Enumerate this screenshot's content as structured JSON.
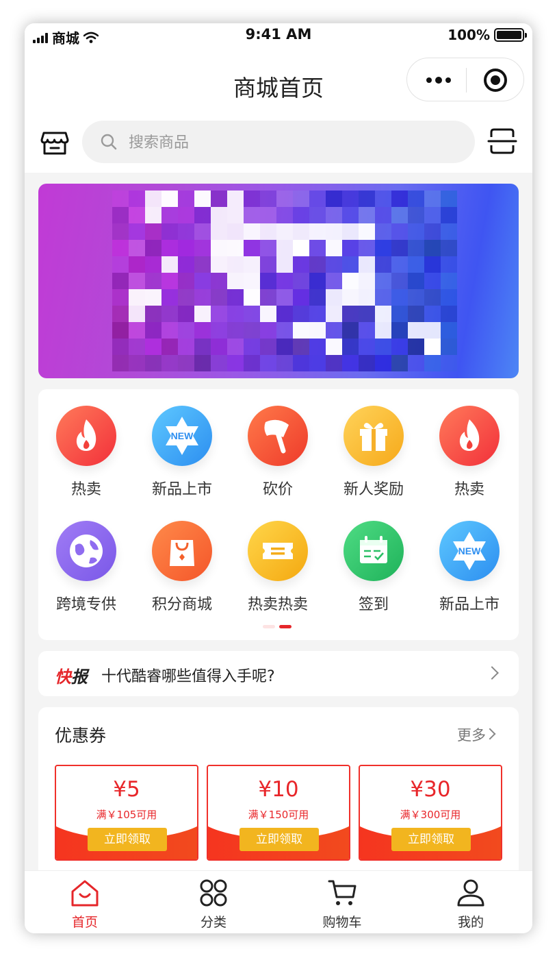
{
  "status_bar": {
    "carrier": "商城",
    "time": "9:41 AM",
    "battery": "100%"
  },
  "nav": {
    "title": "商城首页"
  },
  "search": {
    "placeholder": "搜索商品"
  },
  "grid": {
    "row1": [
      {
        "label": "热卖",
        "icon": "flame-icon"
      },
      {
        "label": "新品上市",
        "icon": "new-badge-icon"
      },
      {
        "label": "砍价",
        "icon": "axe-icon"
      },
      {
        "label": "新人奖励",
        "icon": "gift-icon"
      },
      {
        "label": "热卖",
        "icon": "flame-icon"
      }
    ],
    "row2": [
      {
        "label": "跨境专供",
        "icon": "globe-icon"
      },
      {
        "label": "积分商城",
        "icon": "shopping-bag-icon"
      },
      {
        "label": "热卖热卖",
        "icon": "ticket-icon"
      },
      {
        "label": "签到",
        "icon": "calendar-check-icon"
      },
      {
        "label": "新品上市",
        "icon": "new-badge-icon"
      }
    ],
    "new_badge_text": "NEW",
    "pager_total": 2,
    "pager_active": 2
  },
  "news": {
    "tag_part1": "快",
    "tag_part2": "报",
    "text": "十代酷睿哪些值得入手呢?"
  },
  "coupons": {
    "title": "优惠券",
    "more": "更多",
    "items": [
      {
        "amount": "¥5",
        "condition": "满￥105可用",
        "button": "立即领取"
      },
      {
        "amount": "¥10",
        "condition": "满￥150可用",
        "button": "立即领取"
      },
      {
        "amount": "¥30",
        "condition": "满￥300可用",
        "button": "立即领取"
      }
    ]
  },
  "tabbar": {
    "items": [
      {
        "label": "首页",
        "icon": "home-icon",
        "active": true
      },
      {
        "label": "分类",
        "icon": "category-icon",
        "active": false
      },
      {
        "label": "购物车",
        "icon": "cart-icon",
        "active": false
      },
      {
        "label": "我的",
        "icon": "user-icon",
        "active": false
      }
    ]
  },
  "colors": {
    "accent": "#e5262a",
    "coupon_button": "#f2b51f",
    "page_bg": "#f4f4f4"
  }
}
